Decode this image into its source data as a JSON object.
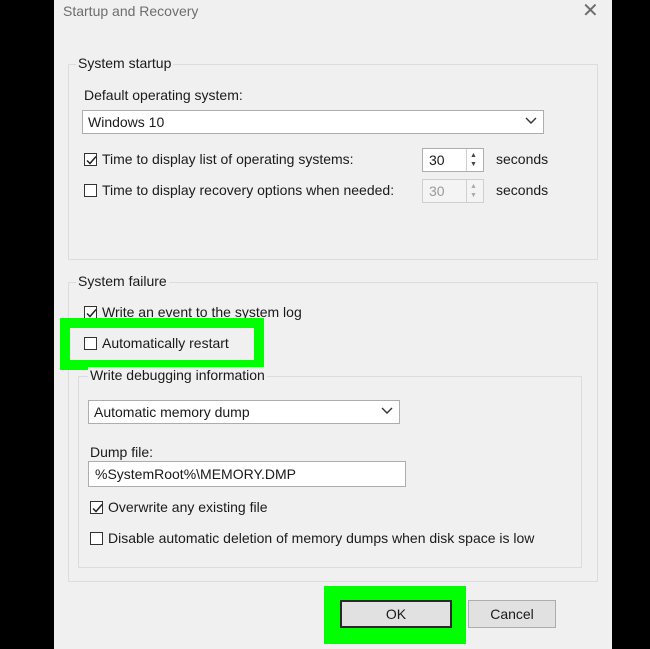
{
  "window": {
    "title": "Startup and Recovery"
  },
  "system_startup": {
    "group_label": "System startup",
    "default_os_label": "Default operating system:",
    "default_os_value": "Windows 10",
    "display_list": {
      "checked": true,
      "label": "Time to display list of operating systems:",
      "value": "30",
      "unit": "seconds"
    },
    "display_recovery": {
      "checked": false,
      "label": "Time to display recovery options when needed:",
      "value": "30",
      "unit": "seconds"
    }
  },
  "system_failure": {
    "group_label": "System failure",
    "write_event": {
      "checked": true,
      "label": "Write an event to the system log"
    },
    "auto_restart": {
      "checked": false,
      "label": "Automatically restart"
    },
    "debug": {
      "group_label": "Write debugging information",
      "dump_type_value": "Automatic memory dump",
      "dump_file_label": "Dump file:",
      "dump_file_value": "%SystemRoot%\\MEMORY.DMP",
      "overwrite": {
        "checked": true,
        "label": "Overwrite any existing file"
      },
      "disable_auto_delete": {
        "checked": false,
        "label": "Disable automatic deletion of memory dumps when disk space is low"
      }
    }
  },
  "buttons": {
    "ok": "OK",
    "cancel": "Cancel"
  },
  "colors": {
    "highlight": "#00ff00",
    "dialog_bg": "#f0f0f0",
    "frame_bg": "#000000"
  }
}
